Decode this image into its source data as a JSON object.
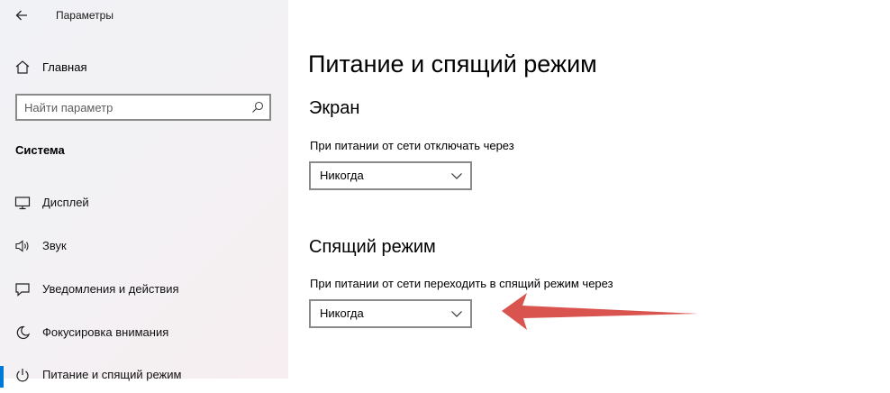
{
  "window": {
    "title": "Параметры"
  },
  "sidebar": {
    "home_label": "Главная",
    "search_placeholder": "Найти параметр",
    "section_title": "Система",
    "items": [
      {
        "label": "Дисплей",
        "icon": "monitor-icon"
      },
      {
        "label": "Звук",
        "icon": "speaker-icon"
      },
      {
        "label": "Уведомления и действия",
        "icon": "notifications-icon"
      },
      {
        "label": "Фокусировка внимания",
        "icon": "moon-icon"
      },
      {
        "label": "Питание и спящий режим",
        "icon": "power-icon",
        "selected": true
      }
    ]
  },
  "main": {
    "page_title": "Питание и спящий режим",
    "screen": {
      "title": "Экран",
      "label": "При питании от сети отключать через",
      "value": "Никогда"
    },
    "sleep": {
      "title": "Спящий режим",
      "label": "При питании от сети переходить в спящий режим через",
      "value": "Никогда"
    }
  },
  "annotation": {
    "arrow_color": "#d9534f"
  },
  "colors": {
    "accent": "#0078d7",
    "control_border": "#8a8a8a"
  }
}
